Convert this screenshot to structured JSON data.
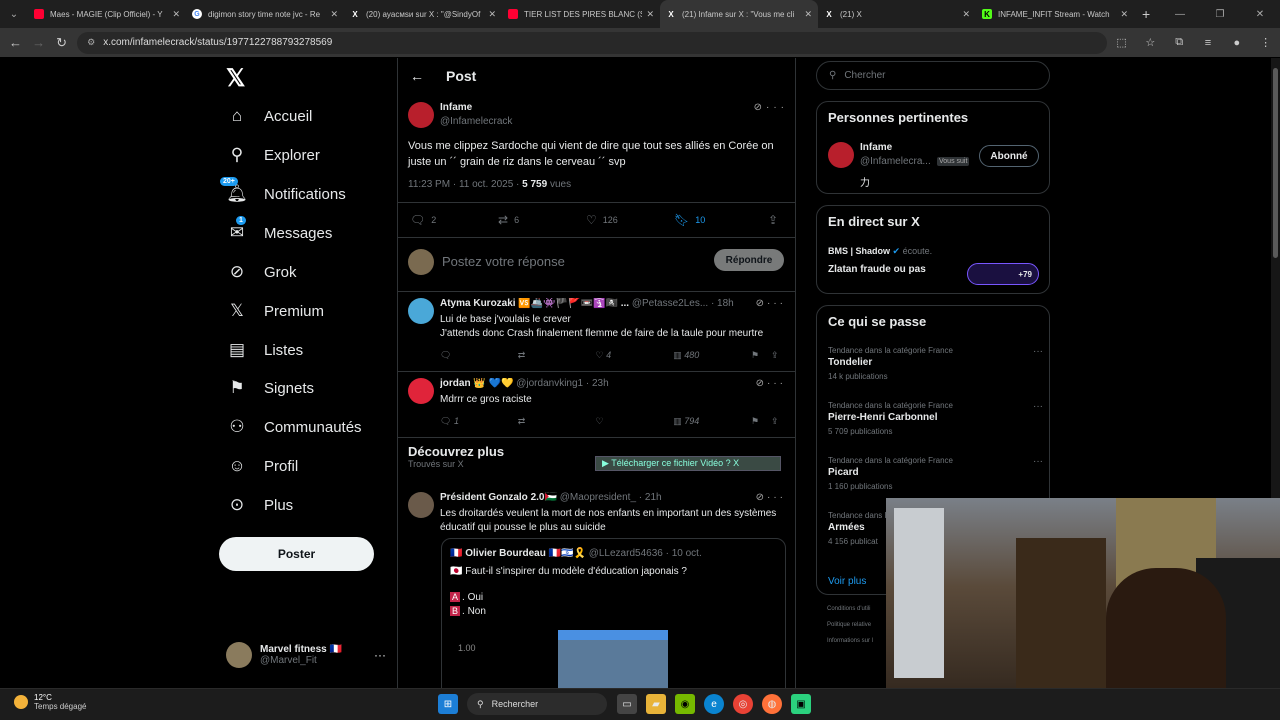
{
  "browser": {
    "tabs": [
      {
        "title": "Maes - MAGIE (Clip Officiel) - Y",
        "icon": "youtube-icon",
        "active": false
      },
      {
        "title": "digimon story time note jvc - Re",
        "icon": "google-icon",
        "active": false
      },
      {
        "title": "(20) ayacмsи sur X : \"@SindyOf",
        "icon": "x-icon",
        "active": false
      },
      {
        "title": "TIER LIST DES PIRES BLANC (SO",
        "icon": "youtube-icon",
        "active": false
      },
      {
        "title": "(21) Infame sur X : \"Vous me cli",
        "icon": "x-icon",
        "active": true
      },
      {
        "title": "(21) X",
        "icon": "x-icon",
        "active": false
      },
      {
        "title": "INFAME_INFIT Stream - Watch",
        "icon": "kick-icon",
        "active": false
      }
    ],
    "url": "x.com/infamelecrack/status/1977122788793278569"
  },
  "sidebar": {
    "items": [
      {
        "label": "Accueil",
        "icon": "home-icon"
      },
      {
        "label": "Explorer",
        "icon": "search-icon"
      },
      {
        "label": "Notifications",
        "icon": "bell-icon",
        "badge": "20+"
      },
      {
        "label": "Messages",
        "icon": "mail-icon",
        "badge": "1"
      },
      {
        "label": "Grok",
        "icon": "grok-icon"
      },
      {
        "label": "Premium",
        "icon": "x-icon"
      },
      {
        "label": "Listes",
        "icon": "list-icon"
      },
      {
        "label": "Signets",
        "icon": "bookmark-icon"
      },
      {
        "label": "Communautés",
        "icon": "people-icon"
      },
      {
        "label": "Profil",
        "icon": "user-icon"
      },
      {
        "label": "Plus",
        "icon": "more-circle-icon"
      }
    ],
    "post_button": "Poster",
    "account": {
      "name": "Marvel fitness 🇫🇷",
      "handle": "@Marvel_Fit"
    }
  },
  "main": {
    "header_title": "Post",
    "post": {
      "name": "Infame",
      "handle": "@Infamelecrack",
      "text": "Vous me clippez Sardoche qui vient de dire que tout ses alliés en Corée on juste un ´´ grain de riz dans le cerveau ´´ svp",
      "time": "11:23 PM · 11 oct. 2025 · ",
      "views": "5 759",
      "views_label": " vues",
      "replies": "2",
      "reposts": "6",
      "likes": "126",
      "bookmarks": "10"
    },
    "reply_placeholder": "Postez votre réponse",
    "reply_button": "Répondre",
    "comments": [
      {
        "name": "Atyma Kurozaki 🆚🚢👾🏴🚩📼🛐🏴‍☠️ ...",
        "handle": "@Petasse2Les... · 18h",
        "line1": "Lui de base j'voulais le crever",
        "line2": "J'attends donc Crash finalement flemme de faire de la taule pour meurtre",
        "replies": "",
        "reposts": "",
        "likes": "4",
        "views": "480"
      },
      {
        "name": "jordan 👑 💙💛",
        "handle": "@jordanvking1 · 23h",
        "line1": "Mdrrr ce gros raciste",
        "replies": "1",
        "reposts": "",
        "likes": "",
        "views": "794"
      }
    ],
    "discover_title": "Découvrez plus",
    "discover_sub": "Trouvés sur X",
    "download_bar": "▶ Télécharger ce fichier Vidéo  ? X",
    "discover_post": {
      "name": "Président Gonzalo 2.0🇵🇸",
      "handle": "@Maopresident_ · 21h",
      "text": "Les droitardés veulent la mort de nos enfants en important un des systèmes éducatif qui pousse le plus au suicide",
      "quote": {
        "name": "🇫🇷 Olivier Bourdeau 🇫🇷🇮🇱🎗️",
        "handle": "@LLezard54636 · 10 oct.",
        "text": "🇯🇵 Faut-il s'inspirer du modèle d'éducation japonais ?",
        "opt_a_letter": "A",
        "opt_a": ". Oui",
        "opt_b_letter": "B",
        "opt_b": ". Non",
        "axis_value": "1.00"
      }
    }
  },
  "right": {
    "search_placeholder": "Chercher",
    "relevant_title": "Personnes pertinentes",
    "relevant": {
      "name": "Infame",
      "handle": "@Infamelecra...",
      "follows_you": "Vous suit",
      "bio": "力",
      "button": "Abonné"
    },
    "live_title": "En direct sur X",
    "live": {
      "host": "BMS | Shadow",
      "host_status": " écoute.",
      "space": "Zlatan fraude ou pas",
      "listeners": "+79"
    },
    "trends_title": "Ce qui se passe",
    "trends": [
      {
        "category": "Tendance dans la catégorie France",
        "name": "Tondelier",
        "posts": "14 k publications"
      },
      {
        "category": "Tendance dans la catégorie France",
        "name": "Pierre-Henri Carbonnel",
        "posts": "5 709 publications"
      },
      {
        "category": "Tendance dans la catégorie France",
        "name": "Picard",
        "posts": "1 160 publications"
      },
      {
        "category": "Tendance dans la",
        "name": "Armées",
        "posts": "4 156 publicat"
      }
    ],
    "see_more": "Voir plus",
    "footer": [
      "Conditions d'utili",
      "Politique relative",
      "Informations sur l"
    ]
  },
  "taskbar": {
    "temp": "12°C",
    "weather": "Temps dégagé",
    "search": "Rechercher"
  },
  "colors": {
    "accent": "#1d9bf0",
    "bg": "#000000",
    "border": "#2f3336"
  }
}
